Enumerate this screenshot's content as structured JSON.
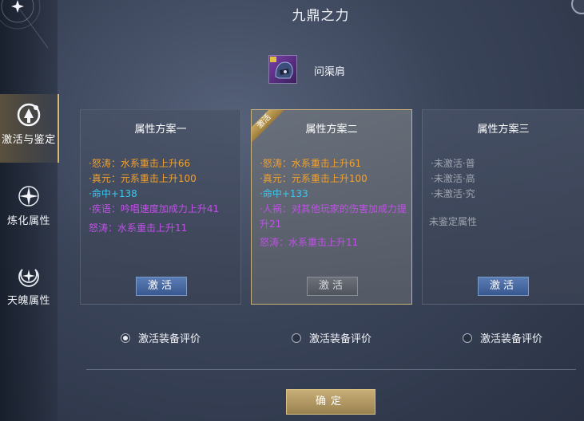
{
  "window": {
    "title": "九鼎之力"
  },
  "item": {
    "name": "问渠肩",
    "icon": "helmet-item-icon"
  },
  "sidebar": {
    "tabs": [
      {
        "label": "激活与鉴定",
        "icon": "activate-icon",
        "active": true
      },
      {
        "label": "炼化属性",
        "icon": "refine-star-icon",
        "active": false
      },
      {
        "label": "天魄属性",
        "icon": "moon-star-icon",
        "active": false
      }
    ]
  },
  "cards": [
    {
      "title": "属性方案一",
      "attrs": [
        "·怒涛：水系重击上升66",
        "·真元：元系重击上升100",
        "·命中+138",
        "·疾语：吟唱速度加成力上升41"
      ],
      "extra": "怒涛：水系重击上升11",
      "button": "激活"
    },
    {
      "title": "属性方案二",
      "badge": "激活",
      "attrs": [
        "·怒涛：水系重击上升61",
        "·真元：元系重击上升100",
        "·命中+133",
        "·人祸：对其他玩家的伤害加成力提升21"
      ],
      "extra": "怒涛：水系重击上升11",
      "button": "激活"
    },
    {
      "title": "属性方案三",
      "attrs": [
        "·未激活·普",
        "·未激活·高",
        "·未激活·究"
      ],
      "extra": "未鉴定属性",
      "button": "激活"
    }
  ],
  "radios": [
    {
      "label": "激活装备评价",
      "checked": true
    },
    {
      "label": "激活装备评价",
      "checked": false
    },
    {
      "label": "激活装备评价",
      "checked": false
    }
  ],
  "confirm_label": "确定",
  "colors": {
    "orange": "#f0a030",
    "cyan": "#38c8f0",
    "purple": "#c050e8",
    "gold": "#c8ae78",
    "blue_button": "#4a6aa4"
  }
}
